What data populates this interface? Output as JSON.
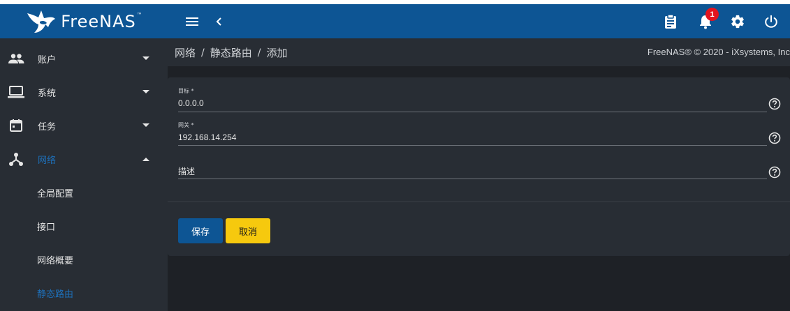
{
  "app": {
    "brand": "FreeNAS",
    "brand_tm": "™",
    "notification_count": "1"
  },
  "sidebar": {
    "items": [
      {
        "label": "账户",
        "icon": "people-icon"
      },
      {
        "label": "系统",
        "icon": "laptop-icon"
      },
      {
        "label": "任务",
        "icon": "calendar-icon"
      },
      {
        "label": "网络",
        "icon": "network-icon",
        "expanded": true
      }
    ],
    "sub_items": [
      {
        "label": "全局配置"
      },
      {
        "label": "接口"
      },
      {
        "label": "网络概要"
      },
      {
        "label": "静态路由",
        "active": true
      }
    ]
  },
  "breadcrumb": [
    "网络",
    "静态路由",
    "添加"
  ],
  "copyright": "FreeNAS® © 2020 - iXsystems, Inc",
  "form": {
    "destination": {
      "label": "目标 *",
      "value": "0.0.0.0"
    },
    "gateway": {
      "label": "网关 *",
      "value": "192.168.14.254"
    },
    "description": {
      "placeholder": "描述",
      "value": ""
    }
  },
  "buttons": {
    "save": "保存",
    "cancel": "取消"
  },
  "colors": {
    "header": "#0d5594",
    "sidebar": "#282d34",
    "background": "#1e2126",
    "accent": "#1e6fb8",
    "cancel": "#f6c90e",
    "badge": "#e4141e"
  }
}
